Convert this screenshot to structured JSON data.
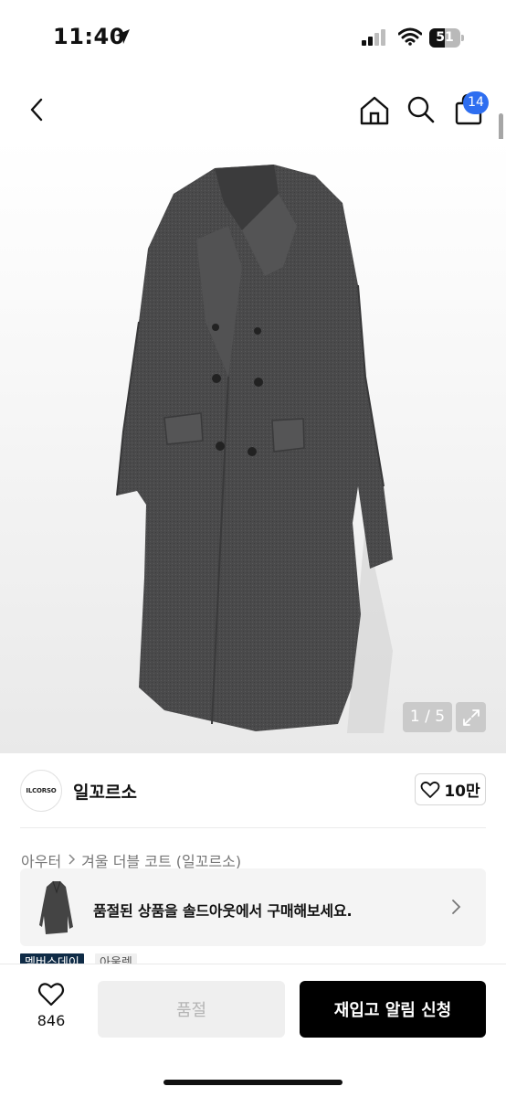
{
  "status_bar": {
    "time": "11:40",
    "battery": "51",
    "battery_level": 0.51
  },
  "header": {
    "back_icon": "chevron-left-icon",
    "home_icon": "home-icon",
    "search_icon": "search-icon",
    "bag_icon": "shopping-bag-icon",
    "bag_count": "14"
  },
  "gallery": {
    "counter": "1 / 5",
    "expand_icon": "expand-icon"
  },
  "brand": {
    "logo_text": "ILCORSO",
    "name": "일꼬르소",
    "like_count": "10만"
  },
  "breadcrumb": {
    "category": "아우터",
    "product": "겨울 더블 코트 (일꼬르소)"
  },
  "soldout_banner": {
    "text": "품절된 상품을 솔드아웃에서 구매해보세요."
  },
  "tags": {
    "member": "멤버스데이",
    "outlet": "아울렛"
  },
  "bottom": {
    "wish_count": "846",
    "soldout_label": "품절",
    "restock_label": "재입고 알림 신청"
  },
  "colors": {
    "accent_blue": "#2e6ef0",
    "primary_button": "#000000",
    "member_tag": "#0f2b46"
  }
}
